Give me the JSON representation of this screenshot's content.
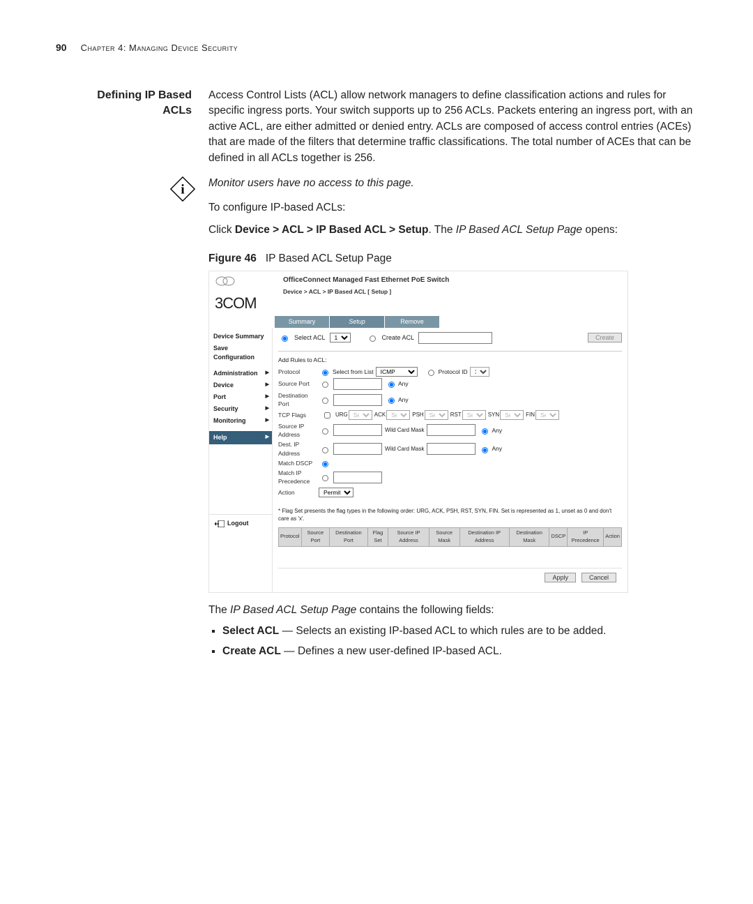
{
  "page_number": "90",
  "chapter_label": "Chapter 4: Managing Device Security",
  "section_heading_l1": "Defining IP Based",
  "section_heading_l2": "ACLs",
  "intro": "Access Control Lists (ACL) allow network managers to define classification actions and rules for specific ingress ports. Your switch supports up to 256 ACLs. Packets entering an ingress port, with an active ACL, are either admitted or denied entry. ACLs are composed of access control entries (ACEs) that are made of the filters that determine traffic classifications. The total number of ACEs that can be defined in all ACLs together is 256.",
  "note_text": "Monitor users have no access to this page.",
  "configure_line": "To configure IP-based ACLs:",
  "click_prefix": "Click ",
  "click_path": "Device > ACL > IP Based ACL > Setup",
  "click_suffix1": ". The ",
  "click_page_name": "IP Based ACL Setup Page",
  "click_suffix2": " opens:",
  "figure_label": "Figure 46",
  "figure_caption": "IP Based ACL Setup Page",
  "screenshot": {
    "logo_text": "3COM",
    "product_title": "OfficeConnect Managed Fast Ethernet PoE Switch",
    "breadcrumb": "Device > ACL > IP Based ACL [ Setup ]",
    "tabs": [
      "Summary",
      "Setup",
      "Remove"
    ],
    "nav": {
      "top": [
        "Device Summary",
        "Save Configuration"
      ],
      "items": [
        "Administration",
        "Device",
        "Port",
        "Security",
        "Monitoring"
      ],
      "help": "Help",
      "logout": "Logout"
    },
    "select_acl": "Select ACL",
    "acl_value": "1",
    "create_acl": "Create ACL",
    "create_btn": "Create",
    "add_rules": "Add Rules to ACL:",
    "rows": {
      "protocol": "Protocol",
      "select_from_list": "Select from List",
      "protocol_val": "ICMP",
      "protocol_id": "Protocol ID",
      "protocol_id_val": "1",
      "source_port": "Source Port",
      "any": "Any",
      "dest_port": "Destination Port",
      "tcp_flags": "TCP Flags",
      "flags": [
        "URG",
        "ACK",
        "PSH",
        "RST",
        "SYN",
        "FIN"
      ],
      "flag_set": "Set",
      "src_ip": "Source IP Address",
      "dst_ip": "Dest. IP Address",
      "wildcard": "Wild Card Mask",
      "match_dscp": "Match DSCP",
      "match_ip_prec": "Match IP Precedence",
      "action": "Action",
      "action_val": "Permit"
    },
    "footnote": "* Flag Set presents the flag types in the following order: URG, ACK, PSH, RST, SYN, FIN. Set is represented as 1, unset as 0 and don't care as 'x'.",
    "table_headers": [
      "Protocol",
      "Source Port",
      "Destination Port",
      "Flag Set",
      "Source IP Address",
      "Source Mask",
      "Destination IP Address",
      "Destination Mask",
      "DSCP",
      "IP Precedence",
      "Action"
    ],
    "apply": "Apply",
    "cancel": "Cancel"
  },
  "after_fig": "The ",
  "after_fig_name": "IP Based ACL Setup Page",
  "after_fig2": " contains the following fields:",
  "fields": [
    {
      "name": "Select ACL",
      "desc": " — Selects an existing IP-based ACL to which rules are to be added."
    },
    {
      "name": "Create ACL",
      "desc": " — Defines a new user-defined IP-based ACL."
    }
  ]
}
